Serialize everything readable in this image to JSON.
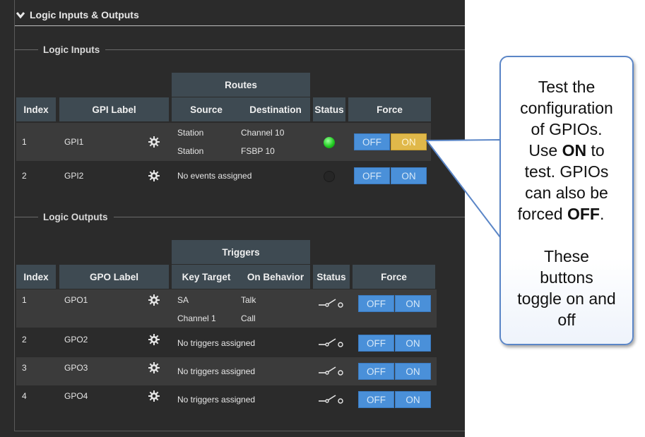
{
  "section": {
    "title": "Logic Inputs & Outputs"
  },
  "inputs": {
    "title": "Logic Inputs",
    "headers": {
      "index": "Index",
      "label": "GPI Label",
      "routes": "Routes",
      "source": "Source",
      "destination": "Destination",
      "status": "Status",
      "force": "Force"
    },
    "rows": [
      {
        "index": "1",
        "label": "GPI1",
        "source1": "Station",
        "dest1": "Channel 10",
        "source2": "Station",
        "dest2": "FSBP 10",
        "status": "active",
        "off": "OFF",
        "on": "ON"
      },
      {
        "index": "2",
        "label": "GPI2",
        "empty": "No events assigned",
        "status": "inactive",
        "off": "OFF",
        "on": "ON"
      }
    ]
  },
  "outputs": {
    "title": "Logic Outputs",
    "headers": {
      "index": "Index",
      "label": "GPO Label",
      "triggers": "Triggers",
      "key_target": "Key Target",
      "on_behavior": "On Behavior",
      "status": "Status",
      "force": "Force"
    },
    "rows": [
      {
        "index": "1",
        "label": "GPO1",
        "key1": "SA",
        "beh1": "Talk",
        "key2": "Channel 1",
        "beh2": "Call",
        "off": "OFF",
        "on": "ON"
      },
      {
        "index": "2",
        "label": "GPO2",
        "empty": "No triggers assigned",
        "off": "OFF",
        "on": "ON"
      },
      {
        "index": "3",
        "label": "GPO3",
        "empty": "No triggers assigned",
        "off": "OFF",
        "on": "ON"
      },
      {
        "index": "4",
        "label": "GPO4",
        "empty": "No triggers assigned",
        "off": "OFF",
        "on": "ON"
      }
    ]
  },
  "callout": {
    "line1": "Test the",
    "line2": "configuration",
    "line3": "of GPIOs.",
    "line4a": "Use ",
    "line4b": "ON",
    "line4c": " to",
    "line5": "test. GPIOs",
    "line6": "can also be",
    "line7a": "forced ",
    "line7b": "OFF",
    "line7c": ".",
    "line8": "These",
    "line9": "buttons",
    "line10": "toggle on and",
    "line11": "off"
  },
  "colors": {
    "button_blue": "#4a90d9",
    "button_on_active": "#e0b84a",
    "led_green": "#22cc22",
    "header_bg": "#3e4a52",
    "callout_border": "#5b86c7"
  }
}
